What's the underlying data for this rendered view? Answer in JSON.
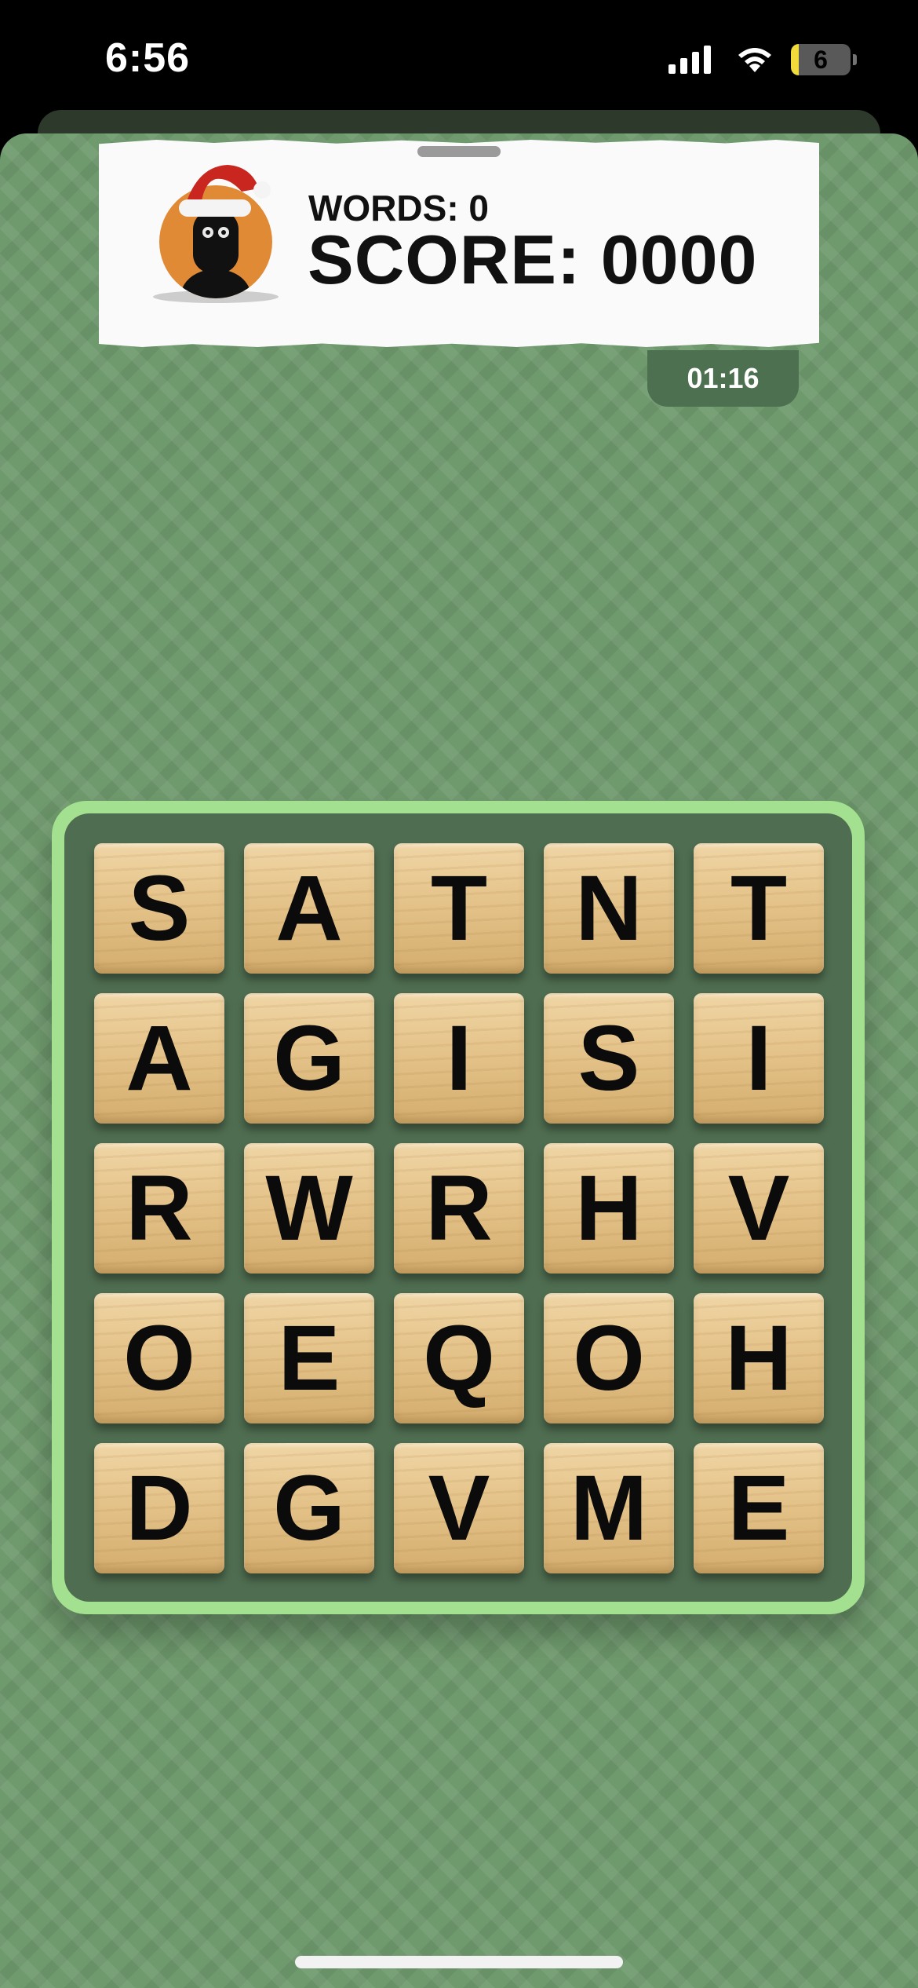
{
  "status_bar": {
    "time": "6:56",
    "battery_percent": "6",
    "battery_level": 0.06,
    "icons": [
      "signal-icon",
      "wifi-icon",
      "battery-icon"
    ]
  },
  "header": {
    "avatar": "santa-hat-character-avatar",
    "words_label": "WORDS: 0",
    "score_label": "SCORE: 0000",
    "timer": "01:16"
  },
  "board": {
    "tiles": [
      [
        "S",
        "A",
        "T",
        "N",
        "T"
      ],
      [
        "A",
        "G",
        "I",
        "S",
        "I"
      ],
      [
        "R",
        "W",
        "R",
        "H",
        "V"
      ],
      [
        "O",
        "E",
        "Q",
        "O",
        "H"
      ],
      [
        "D",
        "G",
        "V",
        "M",
        "E"
      ]
    ]
  },
  "colors": {
    "background": "#6f9a6d",
    "board_border": "#a3e08f",
    "board_inner": "#4f6d50",
    "timer_tab": "#4d7150",
    "tile": "#e7c78f",
    "avatar_circle": "#e08a36"
  }
}
